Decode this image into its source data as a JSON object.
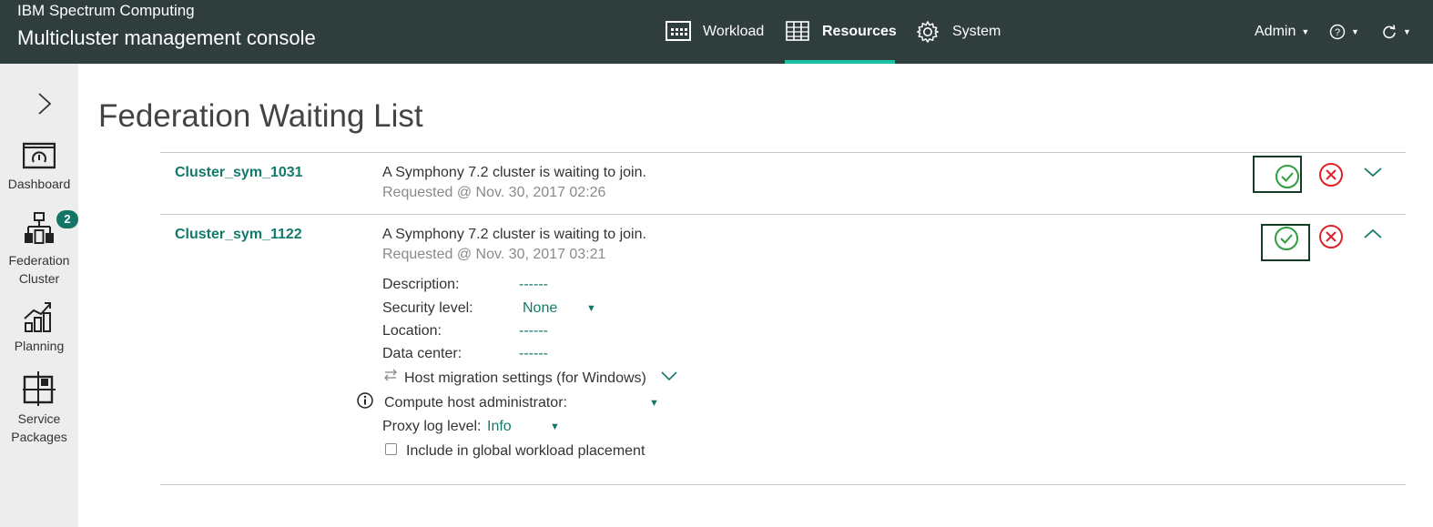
{
  "header": {
    "brand_line1": "IBM Spectrum Computing",
    "brand_line2": "Multicluster management console",
    "nav": {
      "workload": "Workload",
      "resources": "Resources",
      "system": "System"
    },
    "user": "Admin",
    "help_icon": "help-circle-icon",
    "refresh_icon": "refresh-icon",
    "active_accent": "#1dbfa5",
    "bg_color": "#2f3d3d"
  },
  "sidebar": {
    "toggle_icon": "chevron-right-icon",
    "items": [
      {
        "label": "Dashboard",
        "icon": "dashboard-icon"
      },
      {
        "label_line1": "Federation",
        "label_line2": "Cluster",
        "icon": "federation-cluster-icon",
        "badge": "2"
      },
      {
        "label": "Planning",
        "icon": "planning-chart-icon"
      },
      {
        "label_line1": "Service",
        "label_line2": "Packages",
        "icon": "service-packages-icon"
      }
    ]
  },
  "page": {
    "title": "Federation Waiting List"
  },
  "clusters": [
    {
      "name": "Cluster_sym_1031",
      "message": "A Symphony 7.2 cluster is waiting to join.",
      "requested": "Requested @ Nov. 30, 2017 02:26",
      "expanded": false
    },
    {
      "name": "Cluster_sym_1122",
      "message": "A Symphony 7.2 cluster is waiting to join.",
      "requested": "Requested @ Nov. 30, 2017 03:21",
      "expanded": true,
      "details": {
        "description_label": "Description:",
        "description_value": "------",
        "security_label": "Security level:",
        "security_value": "None",
        "location_label": "Location:",
        "location_value": "------",
        "datacenter_label": "Data center:",
        "datacenter_value": "------",
        "host_migration_label": "Host migration settings (for Windows)",
        "compute_admin_label": "Compute host administrator:",
        "compute_admin_value": "",
        "proxy_log_label": "Proxy log level:",
        "proxy_log_value": "Info",
        "global_placement_label": "Include in global workload placement",
        "global_placement_checked": false
      }
    }
  ],
  "colors": {
    "accept": "#2e9e3e",
    "reject": "#e0202c",
    "link": "#137a6a"
  }
}
